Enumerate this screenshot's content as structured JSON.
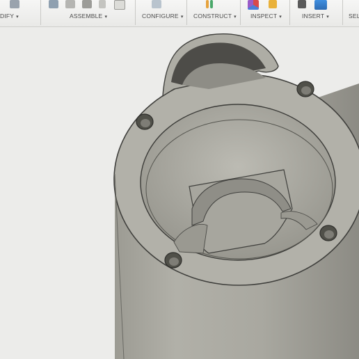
{
  "toolbar": {
    "groups": [
      {
        "label": "DIFY",
        "icon": "modify-icon"
      },
      {
        "label": "ASSEMBLE",
        "icon": "assemble-icon"
      },
      {
        "label": "CONFIGURE",
        "icon": "configure-icon"
      },
      {
        "label": "CONSTRUCT",
        "icon": "construct-icon"
      },
      {
        "label": "INSPECT",
        "icon": "inspect-icon"
      },
      {
        "label": "INSERT",
        "icon": "insert-icon"
      },
      {
        "label": "SEL",
        "icon": "select-icon"
      }
    ],
    "caret": "▾"
  },
  "viewport": {
    "model": "cylindrical-housing",
    "body_color": "#a9a89f",
    "background": "#ececea"
  }
}
